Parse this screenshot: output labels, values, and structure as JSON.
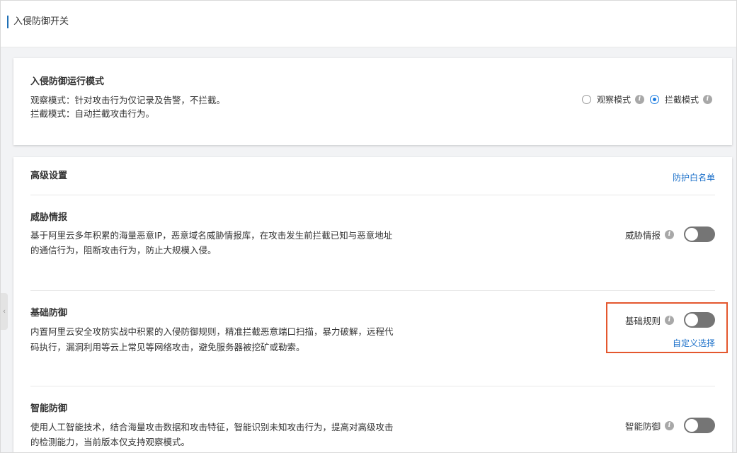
{
  "header": {
    "title": "入侵防御开关"
  },
  "mode_card": {
    "title": "入侵防御运行模式",
    "desc_observe": "观察模式：针对攻击行为仅记录及告警，不拦截。",
    "desc_block": "拦截模式：自动拦截攻击行为。",
    "options": [
      {
        "label": "观察模式",
        "checked": false
      },
      {
        "label": "拦截模式",
        "checked": true
      }
    ],
    "info_glyph": "i"
  },
  "advanced": {
    "title": "高级设置",
    "whitelist_link": "防护白名单",
    "sections": [
      {
        "title": "威胁情报",
        "desc_line1": "基于阿里云多年积累的海量恶意IP，恶意域名威胁情报库，在攻击发生前拦截已知与恶意地址",
        "desc_line2": "的通信行为，阻断攻击行为，防止大规模入侵。",
        "switch_label": "威胁情报",
        "enabled": false
      },
      {
        "title": "基础防御",
        "desc_line1": "内置阿里云安全攻防实战中积累的入侵防御规则，精准拦截恶意端口扫描，暴力破解，远程代",
        "desc_line2": "码执行，漏洞利用等云上常见等网络攻击，避免服务器被挖矿或勒索。",
        "switch_label": "基础规则",
        "enabled": false,
        "custom_link": "自定义选择"
      },
      {
        "title": "智能防御",
        "desc_line1": "使用人工智能技术，结合海量攻击数据和攻击特征，智能识别未知攻击行为，提高对高级攻击",
        "desc_line2": "的检测能力，当前版本仅支持观察模式。",
        "switch_label": "智能防御",
        "enabled": false
      }
    ]
  },
  "colors": {
    "accent": "#1a7be0",
    "link": "#1a6fc9",
    "toggle_off": "#757575",
    "highlight": "#e4572e"
  },
  "side_handle_glyph": "‹"
}
